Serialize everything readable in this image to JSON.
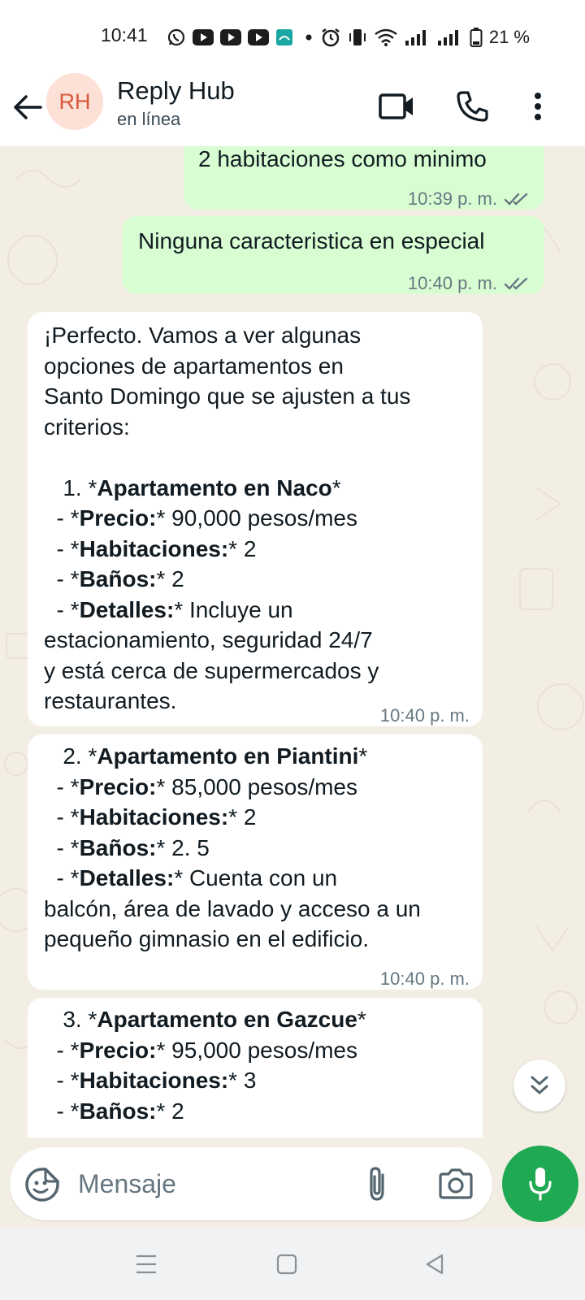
{
  "status_bar": {
    "time": "10:41",
    "battery": "21 %",
    "icons": [
      "whatsapp-icon",
      "youtube-icon",
      "youtube-icon",
      "youtube-icon",
      "app-icon",
      "dot-icon",
      "alarm-icon",
      "vibrate-icon",
      "wifi-icon",
      "signal-icon",
      "signal-icon",
      "battery-icon"
    ]
  },
  "header": {
    "avatar_initials": "RH",
    "contact_name": "Reply Hub",
    "contact_status": "en línea"
  },
  "colors": {
    "outgoing_bubble": "#d9fdd3",
    "incoming_bubble": "#ffffff",
    "chat_background": "#f3eee4",
    "accent_green": "#1ea952",
    "read_ticks": "#53bdeb",
    "avatar_bg": "#fde0d6",
    "avatar_text": "#d5593b"
  },
  "messages": {
    "m1": {
      "text": "2 habitaciones como minimo",
      "time": "10:39 p. m.",
      "status": "read"
    },
    "m2": {
      "text": "Ninguna caracteristica en especial",
      "time": "10:40 p. m.",
      "status": "read"
    },
    "m3": {
      "intro_1": "¡Perfecto. Vamos a ver algunas",
      "intro_2": "opciones de apartamentos en",
      "intro_3": "Santo Domingo que se ajusten a tus",
      "intro_4": "criterios:",
      "title_pre": "   1. *",
      "title": "Apartamento en Naco",
      "title_post": "*",
      "price_pre": "  - *",
      "price_label": "Precio:",
      "price_post": "* 90,000 pesos/mes",
      "rooms_pre": "  - *",
      "rooms_label": "Habitaciones:",
      "rooms_post": "* 2",
      "baths_pre": "  - *",
      "baths_label": "Baños:",
      "baths_post": "* 2",
      "details_pre": "  - *",
      "details_label": "Detalles:",
      "details_post": "* Incluye un",
      "details_2": "estacionamiento, seguridad 24/7",
      "details_3": "y está cerca de supermercados y",
      "details_4": "restaurantes.",
      "time": "10:40 p. m."
    },
    "m4": {
      "title_pre": "   2. *",
      "title": "Apartamento en Piantini",
      "title_post": "*",
      "price_pre": "  - *",
      "price_label": "Precio:",
      "price_post": "* 85,000 pesos/mes",
      "rooms_pre": "  - *",
      "rooms_label": "Habitaciones:",
      "rooms_post": "* 2",
      "baths_pre": "  - *",
      "baths_label": "Baños:",
      "baths_post": "* 2. 5",
      "details_pre": "  - *",
      "details_label": "Detalles:",
      "details_post": "* Cuenta con un",
      "details_2": "balcón, área de lavado y acceso a un",
      "details_3": "pequeño gimnasio en el edificio.",
      "time": "10:40 p. m."
    },
    "m5": {
      "title_pre": "   3. *",
      "title": "Apartamento en Gazcue",
      "title_post": "*",
      "price_pre": "  - *",
      "price_label": "Precio:",
      "price_post": "* 95,000 pesos/mes",
      "rooms_pre": "  - *",
      "rooms_label": "Habitaciones:",
      "rooms_post": "* 3",
      "baths_pre": "  - *",
      "baths_label": "Baños:",
      "baths_post": "* 2"
    }
  },
  "composer": {
    "placeholder": "Mensaje"
  }
}
